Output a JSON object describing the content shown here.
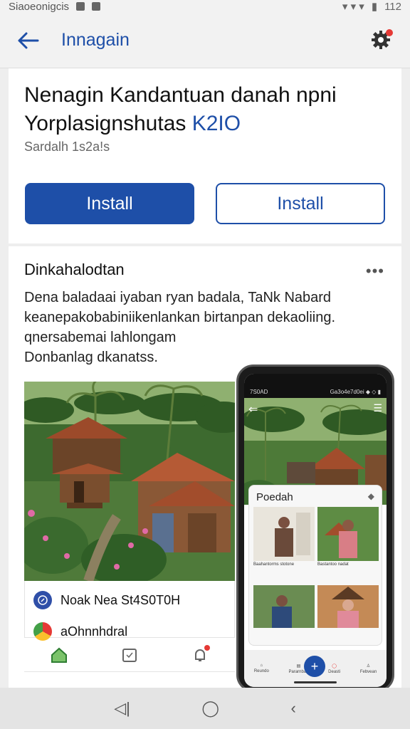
{
  "status_bar": {
    "carrier": "Siaoeonigcis",
    "time": "112"
  },
  "app_bar": {
    "title": "Innagain",
    "back_icon": "arrow-left-icon",
    "settings_icon": "gear-icon"
  },
  "header": {
    "title_line1": "Nenagin Kandantuan danah npni",
    "title_line2": "Yorplasignshutas",
    "title_accent": "K2IO",
    "subtitle": "Sardalh 1s2a!s",
    "primary_button": "Install",
    "secondary_button": "Install"
  },
  "details": {
    "section_title": "Dinkahalodtan",
    "more_label": "•••",
    "description": [
      "Dena baladaai iyaban ryan badala, TaNk Nabard",
      "keanepakobabiniikenlankan birtanpan dekaoliing.",
      "qnersabemai lahlongam",
      "Donbanlag dkanatss."
    ],
    "list": [
      {
        "label": "Noak Nea St4S0T0H",
        "icon": "compass-icon"
      },
      {
        "label": "aOhnnhdral",
        "icon": "chrome-icon"
      }
    ],
    "tabs": [
      {
        "icon": "home-icon"
      },
      {
        "icon": "calendar-icon"
      },
      {
        "icon": "notification-icon"
      }
    ]
  },
  "phone": {
    "status_left": "7S0AD",
    "status_right": "Ga3o4e7d0ei  ◆ ◇ ▮",
    "sheet_title": "Poedah",
    "captions": [
      "Baahantorms stotone",
      "Bastantoo nadat"
    ],
    "nav": [
      "Reundo",
      "Pararnban",
      "Deasti",
      "Febvean"
    ],
    "fab": "+"
  },
  "colors": {
    "accent": "#1e4fa8",
    "badge": "#e53935"
  }
}
